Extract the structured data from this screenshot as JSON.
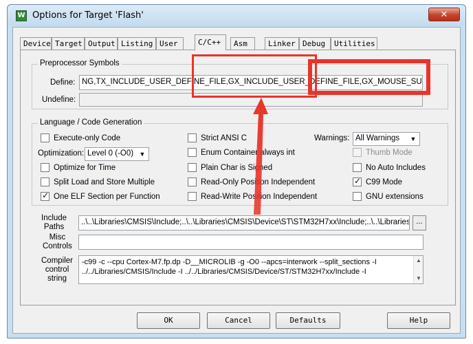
{
  "window": {
    "title": "Options for Target 'Flash'",
    "app_icon": "W",
    "close_glyph": "✕"
  },
  "tabs": [
    {
      "label": "Device"
    },
    {
      "label": "Target"
    },
    {
      "label": "Output"
    },
    {
      "label": "Listing"
    },
    {
      "label": "User"
    },
    {
      "label": "C/C++"
    },
    {
      "label": "Asm"
    },
    {
      "label": "Linker"
    },
    {
      "label": "Debug"
    },
    {
      "label": "Utilities"
    }
  ],
  "preprocessor": {
    "group_title": "Preprocessor Symbols",
    "define_label": "Define:",
    "define_value": "NG,TX_INCLUDE_USER_DEFINE_FILE,GX_INCLUDE_USER_DEFINE_FILE,GX_MOUSE_SUPPORT",
    "undefine_label": "Undefine:",
    "undefine_value": ""
  },
  "language": {
    "group_title": "Language / Code Generation",
    "execute_only": "Execute-only Code",
    "optimization_label": "Optimization:",
    "optimization_value": "Level 0 (-O0)",
    "optimize_time": "Optimize for Time",
    "split_load": "Split Load and Store Multiple",
    "one_elf": "One ELF Section per Function",
    "strict_ansi": "Strict ANSI C",
    "enum_container": "Enum Container always int",
    "plain_char": "Plain Char is Signed",
    "ro_pi": "Read-Only Position Independent",
    "rw_pi": "Read-Write Position Independent",
    "warnings_label": "Warnings:",
    "warnings_value": "All Warnings",
    "thumb_mode": "Thumb Mode",
    "no_auto_includes": "No Auto Includes",
    "c99_mode": "C99 Mode",
    "gnu_ext": "GNU extensions"
  },
  "include": {
    "label_line1": "Include",
    "label_line2": "Paths",
    "value": "..\\..\\Libraries\\CMSIS\\Include;..\\..\\Libraries\\CMSIS\\Device\\ST\\STM32H7xx\\Include;..\\..\\Libraries\\S",
    "browse": "..."
  },
  "misc": {
    "label_line1": "Misc",
    "label_line2": "Controls",
    "value": ""
  },
  "compiler": {
    "label_line1": "Compiler",
    "label_line2": "control",
    "label_line3": "string",
    "line1": "-c99 -c --cpu Cortex-M7.fp.dp -D__MICROLIB -g -O0 --apcs=interwork --split_sections -I",
    "line2": "../../Libraries/CMSIS/Include -I ../../Libraries/CMSIS/Device/ST/STM32H7xx/Include -I"
  },
  "buttons": {
    "ok": "OK",
    "cancel": "Cancel",
    "defaults": "Defaults",
    "help": "Help"
  },
  "annotation_color": "#e8342a"
}
